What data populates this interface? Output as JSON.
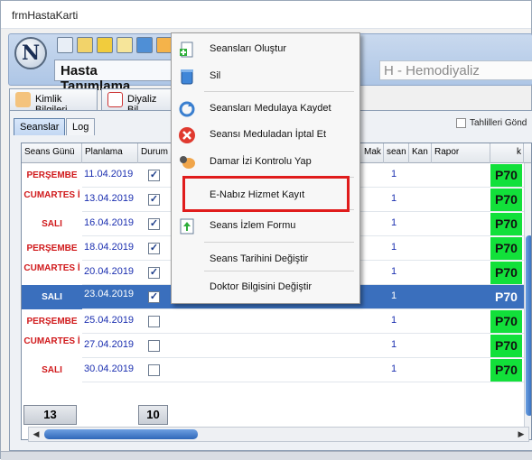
{
  "window": {
    "title": "frmHastaKarti"
  },
  "toolbar": {
    "logo_text": "N",
    "patient_title": "Hasta Tanımlama",
    "department": "H - Hemodiyaliz"
  },
  "main_tabs": [
    {
      "label": "Kimlik Bilgileri",
      "icon": "person-icon"
    },
    {
      "label": "Diyaliz Bil",
      "icon": "chart-icon"
    }
  ],
  "sub_tabs": [
    {
      "label": "Seanslar"
    },
    {
      "label": "Log"
    }
  ],
  "tahlil_label": "Tahlilleri Gönd",
  "grid": {
    "columns": [
      "Seans Günü",
      "Planlama",
      "Durum",
      "Mak",
      "sean",
      "Kan",
      "Rapor",
      "k"
    ],
    "rows": [
      {
        "day": "PERŞEMBE",
        "date": "11.04.2019",
        "checked": "✓",
        "num": "1",
        "code": "P70"
      },
      {
        "day": "CUMARTES İ",
        "date": "13.04.2019",
        "checked": "✓",
        "num": "1",
        "code": "P70"
      },
      {
        "day": "SALI",
        "date": "16.04.2019",
        "checked": "✓",
        "num": "1",
        "code": "P70"
      },
      {
        "day": "PERŞEMBE",
        "date": "18.04.2019",
        "checked": "✓",
        "num": "1",
        "code": "P70"
      },
      {
        "day": "CUMARTES İ",
        "date": "20.04.2019",
        "checked": "✓",
        "num": "1",
        "code": "P70"
      },
      {
        "day": "SALI",
        "date": "23.04.2019",
        "checked": "✓",
        "num": "1",
        "code": "P70"
      },
      {
        "day": "PERŞEMBE",
        "date": "25.04.2019",
        "checked": "",
        "num": "1",
        "code": "P70"
      },
      {
        "day": "CUMARTES İ",
        "date": "27.04.2019",
        "checked": "",
        "num": "1",
        "code": "P70"
      },
      {
        "day": "SALI",
        "date": "30.04.2019",
        "checked": "",
        "num": "1",
        "code": "P70"
      }
    ],
    "footer_count_1": "13",
    "footer_count_2": "10"
  },
  "context_menu": {
    "items": [
      {
        "label": "Seansları Oluştur",
        "icon": "add-document-icon"
      },
      {
        "label": "Sil",
        "icon": "trash-icon"
      },
      {
        "label": "Seansları Medulaya Kaydet",
        "icon": "refresh-icon"
      },
      {
        "label": "Seansı Meduladan İptal Et",
        "icon": "cancel-icon"
      },
      {
        "label": "Damar İzi Kontrolu Yap",
        "icon": "fingerprint-icon"
      },
      {
        "label": "E-Nabız Hizmet Kayıt",
        "icon": ""
      },
      {
        "label": "Seans İzlem Formu",
        "icon": "upload-document-icon"
      },
      {
        "label": "Seans Tarihini Değiştir",
        "icon": ""
      },
      {
        "label": "Doktor Bilgisini Değiştir",
        "icon": ""
      }
    ]
  },
  "colors": {
    "selected_row": "#3a6fbd",
    "day_red": "#d0191b",
    "code_green": "#12e03a",
    "highlight_red": "#e01c1c"
  }
}
